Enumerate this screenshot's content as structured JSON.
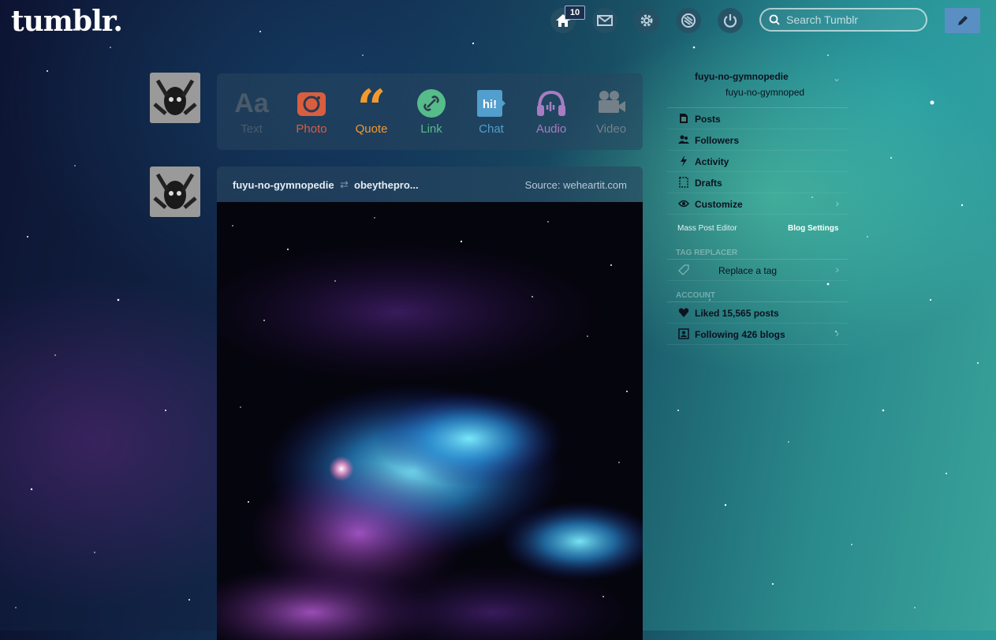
{
  "header": {
    "logo": "tumblr.",
    "dashboard_badge": "10",
    "search_placeholder": "Search Tumblr",
    "nav": [
      {
        "icon": "home-icon"
      },
      {
        "icon": "mail-icon"
      },
      {
        "icon": "gear-icon"
      },
      {
        "icon": "xkit-icon"
      },
      {
        "icon": "power-icon"
      }
    ],
    "compose_icon": "pencil-icon"
  },
  "post_types": [
    {
      "label": "Text",
      "icon": "text-icon",
      "color": "#4a5a6a"
    },
    {
      "label": "Photo",
      "icon": "camera-icon",
      "color": "#d95e40"
    },
    {
      "label": "Quote",
      "icon": "quote-icon",
      "color": "#f2992e"
    },
    {
      "label": "Link",
      "icon": "link-icon",
      "color": "#56bc8a"
    },
    {
      "label": "Chat",
      "icon": "chat-icon",
      "color": "#529ecc"
    },
    {
      "label": "Audio",
      "icon": "headphones-icon",
      "color": "#a77dc2"
    },
    {
      "label": "Video",
      "icon": "video-camera-icon",
      "color": "#748089"
    }
  ],
  "post": {
    "author": "fuyu-no-gymnopedie",
    "reblogged_from": "obeythepro...",
    "source": "Source: weheartit.com"
  },
  "sidebar": {
    "blog_name": "fuyu-no-gymnopedie",
    "blog_title": "fuyu-no-gymnoped",
    "items": [
      {
        "label": "Posts",
        "icon": "posts-icon"
      },
      {
        "label": "Followers",
        "icon": "followers-icon"
      },
      {
        "label": "Activity",
        "icon": "activity-icon"
      },
      {
        "label": "Drafts",
        "icon": "drafts-icon"
      },
      {
        "label": "Customize",
        "icon": "eye-icon"
      }
    ],
    "mass_post_editor": "Mass Post Editor",
    "blog_settings": "Blog Settings",
    "tag_replacer_header": "TAG REPLACER",
    "replace_tag": "Replace a tag",
    "account_header": "ACCOUNT",
    "liked": "Liked 15,565 posts",
    "following": "Following 426 blogs"
  }
}
